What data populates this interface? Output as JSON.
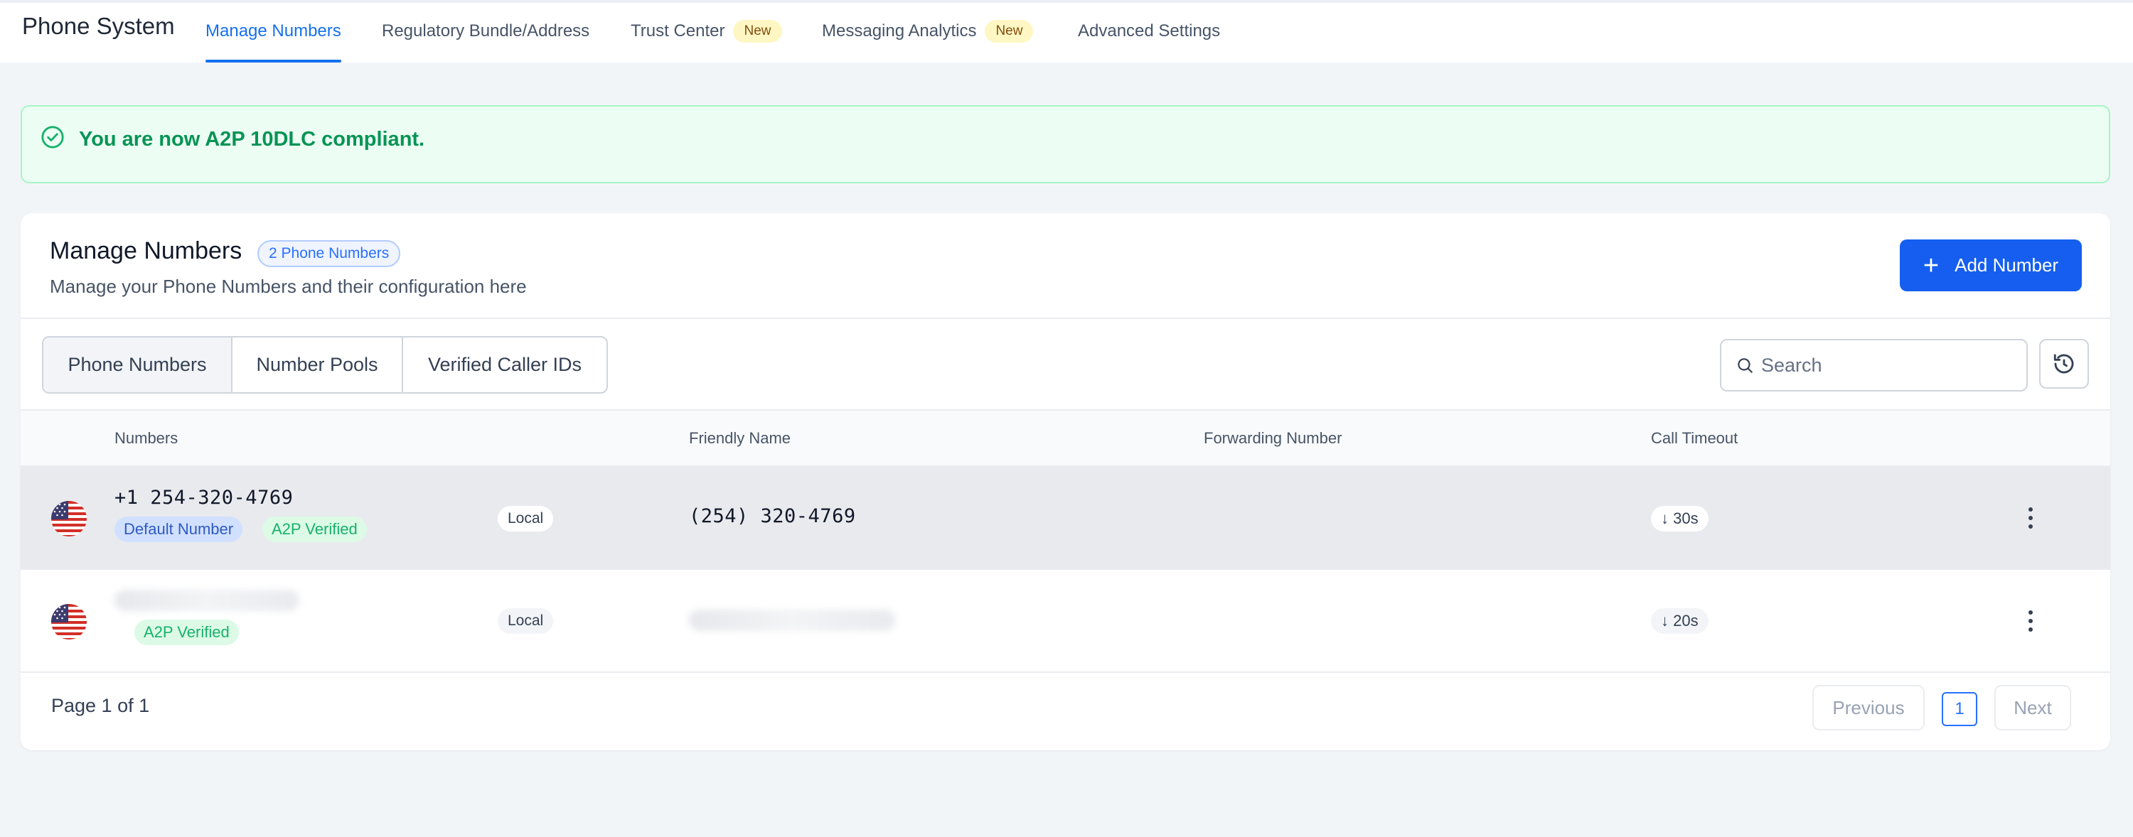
{
  "nav": {
    "app_title": "Phone System",
    "tabs": [
      {
        "label": "Manage Numbers"
      },
      {
        "label": "Regulatory Bundle/Address"
      },
      {
        "label": "Trust Center",
        "badge": "New"
      },
      {
        "label": "Messaging Analytics",
        "badge": "New"
      },
      {
        "label": "Advanced Settings"
      }
    ]
  },
  "banner": {
    "text": "You are now A2P 10DLC compliant."
  },
  "card": {
    "title": "Manage Numbers",
    "count_badge": "2 Phone Numbers",
    "subtitle": "Manage your Phone Numbers and their configuration here",
    "add_button": "Add Number"
  },
  "segments": [
    "Phone Numbers",
    "Number Pools",
    "Verified Caller IDs"
  ],
  "search": {
    "placeholder": "Search"
  },
  "table": {
    "headers": [
      "Numbers",
      "Friendly Name",
      "Forwarding Number",
      "Call Timeout"
    ],
    "rows": [
      {
        "number": "+1 254-320-4769",
        "badges": [
          "Default Number",
          "A2P Verified"
        ],
        "type": "Local",
        "friendly_name": "(254) 320-4769",
        "timeout": "↓ 30s"
      },
      {
        "number": "",
        "badges": [
          "A2P Verified"
        ],
        "type": "Local",
        "friendly_name": "",
        "timeout": "↓ 20s"
      }
    ]
  },
  "pagination": {
    "label": "Page 1 of 1",
    "previous": "Previous",
    "current": "1",
    "next": "Next"
  },
  "colors": {
    "primary": "#155eef",
    "success": "#079455",
    "active_tab": "#1570ef"
  }
}
